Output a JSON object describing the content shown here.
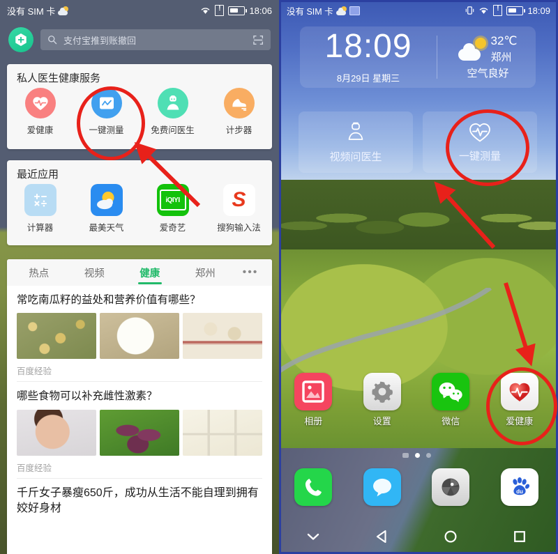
{
  "left_phone": {
    "status_bar": {
      "carrier": "没有 SIM 卡",
      "time": "18:06",
      "icons": [
        "weather-sun-cloud-icon",
        "wifi-icon",
        "sim-card-alert-icon",
        "battery-icon"
      ]
    },
    "search": {
      "logo_icon": "baidu-plus-logo-icon",
      "search_icon": "search-icon",
      "query": "支付宝推到账撤回",
      "scan_icon": "scan-code-icon"
    },
    "health_card": {
      "title": "私人医生健康服务",
      "items": [
        {
          "label": "爱健康",
          "icon": "heart-pulse-icon",
          "color": "#f98080"
        },
        {
          "label": "一键测量",
          "icon": "measure-chart-icon",
          "color": "#41a0ef"
        },
        {
          "label": "免费问医生",
          "icon": "doctor-icon",
          "color": "#4fdfb4"
        },
        {
          "label": "计步器",
          "icon": "running-shoe-icon",
          "color": "#f9ad62"
        }
      ]
    },
    "recent_card": {
      "title": "最近应用",
      "items": [
        {
          "label": "计算器",
          "icon": "calculator-icon",
          "color": "#b8dcf4"
        },
        {
          "label": "最美天气",
          "icon": "weather-app-icon",
          "color": "#2a8cf0"
        },
        {
          "label": "爱奇艺",
          "icon": "iqiyi-icon",
          "color": "#13c20b",
          "mark": "iQIYI"
        },
        {
          "label": "搜狗输入法",
          "icon": "sogou-icon",
          "color": "#ffffff",
          "mark": "S"
        }
      ]
    },
    "feed": {
      "tabs": [
        {
          "label": "热点",
          "active": false
        },
        {
          "label": "视频",
          "active": false
        },
        {
          "label": "健康",
          "active": true
        },
        {
          "label": "郑州",
          "active": false
        },
        {
          "label": "•••",
          "active": false
        }
      ],
      "active_color": "#22ba6a",
      "items": [
        {
          "title": "常吃南瓜籽的益处和营养价值有哪些？",
          "source": "百度经验",
          "thumbs": 3
        },
        {
          "title": "哪些食物可以补充雌性激素？",
          "source": "百度经验",
          "thumbs": 3
        },
        {
          "title": "千斤女子暴瘦650斤，成功从生活不能自理到拥有姣好身材",
          "source": "",
          "thumbs": 0
        }
      ]
    }
  },
  "right_phone": {
    "status_bar": {
      "carrier": "没有 SIM 卡",
      "time": "18:09",
      "icons": [
        "weather-sun-cloud-icon",
        "screenshot-icon",
        "vibrate-icon",
        "wifi-icon",
        "sim-card-alert-icon",
        "battery-icon"
      ]
    },
    "clock_widget": {
      "time": "18:09",
      "date": "8月29日 星期三",
      "weather_icon": "sun-behind-cloud-icon",
      "temperature": "32℃",
      "city": "郑州",
      "air_quality": "空气良好"
    },
    "shortcuts": [
      {
        "label": "视频问医生",
        "icon": "doctor-outline-icon"
      },
      {
        "label": "一键测量",
        "icon": "heart-pulse-outline-icon"
      }
    ],
    "apps_row1": [
      {
        "label": "相册",
        "icon": "photos-icon",
        "color": "#f5455f"
      },
      {
        "label": "设置",
        "icon": "gear-icon",
        "color": "#d8d8d8"
      },
      {
        "label": "微信",
        "icon": "wechat-icon",
        "color": "#19c40f"
      },
      {
        "label": "爱健康",
        "icon": "heart-pulse-app-icon",
        "color": "#e23b3b"
      }
    ],
    "apps_row2": [
      {
        "label": "",
        "icon": "phone-icon",
        "color": "#24d64a"
      },
      {
        "label": "",
        "icon": "message-icon",
        "color": "#31b6f5"
      },
      {
        "label": "",
        "icon": "camera-icon",
        "color": "#cfcfcf"
      },
      {
        "label": "",
        "icon": "baidu-paw-icon",
        "color": "#2a5fd8"
      }
    ],
    "page_dots": {
      "count": 3,
      "active_index": 1
    },
    "nav_bar": [
      "chevron-down-icon",
      "back-triangle-icon",
      "home-circle-icon",
      "recents-square-icon"
    ]
  },
  "annotations": {
    "accent_color": "#e8211a",
    "circles": [
      {
        "target": "left-one-tap-measure"
      },
      {
        "target": "right-one-tap-measure"
      },
      {
        "target": "right-health-app"
      }
    ],
    "arrows": [
      {
        "from": "recent-apps-area",
        "to": "left-one-tap-measure"
      },
      {
        "from": "golf-background",
        "to": "right-one-tap-measure"
      },
      {
        "from": "golf-background",
        "to": "right-health-app"
      }
    ]
  }
}
